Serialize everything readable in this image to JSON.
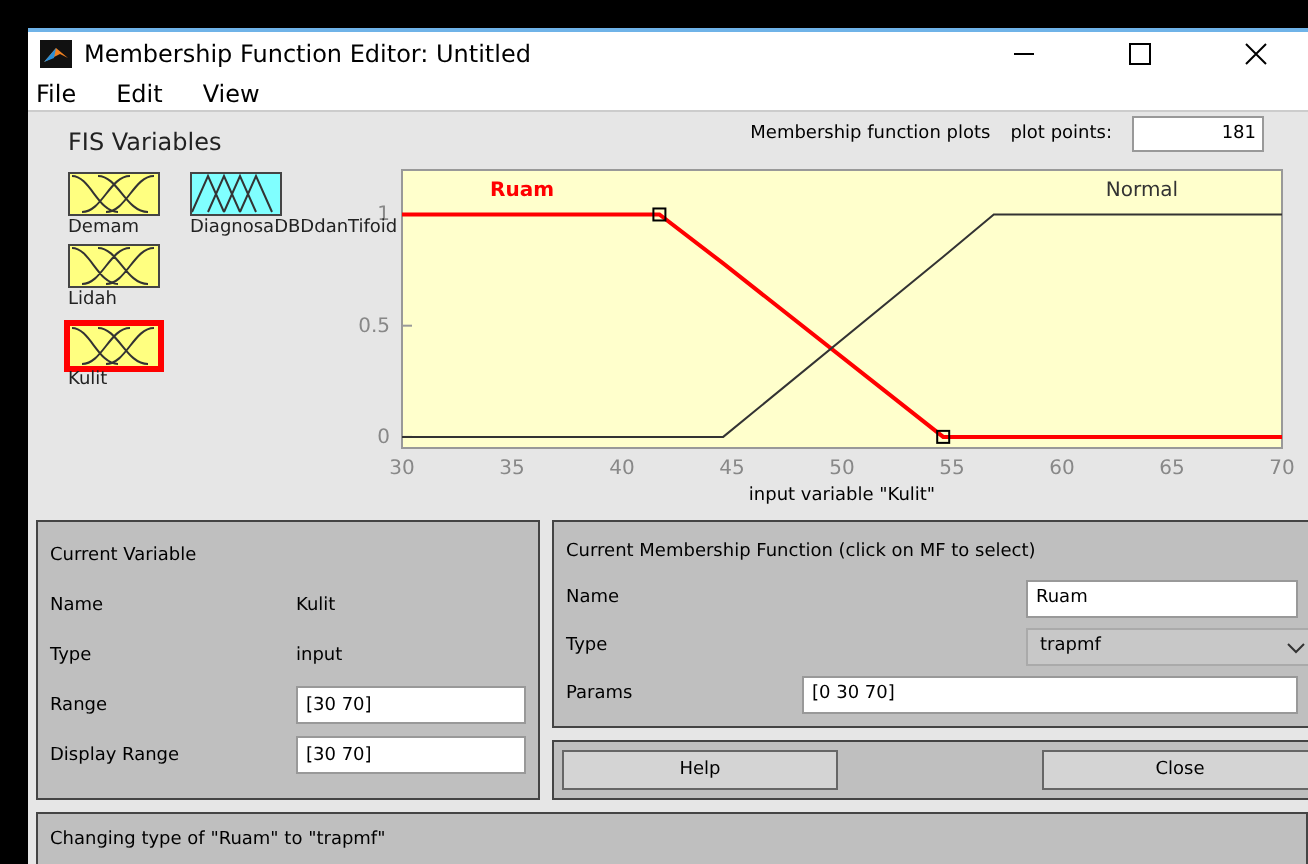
{
  "window": {
    "title": "Membership Function Editor: Untitled"
  },
  "menu": [
    "File",
    "Edit",
    "View"
  ],
  "fis_variables": {
    "title": "FIS Variables",
    "items": [
      {
        "label": "Demam",
        "kind": "input",
        "selected": false
      },
      {
        "label": "DiagnosaDBDdanTifoid",
        "kind": "output",
        "selected": false
      },
      {
        "label": "Lidah",
        "kind": "input",
        "selected": false
      },
      {
        "label": "Kulit",
        "kind": "input",
        "selected": true
      }
    ]
  },
  "plot": {
    "title": "Membership function plots",
    "plot_points_label": "plot points:",
    "plot_points": "181",
    "chart_data": {
      "type": "line",
      "xlabel": "input variable \"Kulit\"",
      "x": [
        30,
        41.7,
        44.6,
        54.6,
        56.9,
        70
      ],
      "series": [
        {
          "name": "Ruam",
          "color": "#ff0000",
          "values": [
            1,
            1,
            0.78,
            0,
            0,
            0
          ]
        },
        {
          "name": "Normal",
          "color": "#333333",
          "values": [
            0,
            0,
            0,
            0.81,
            1,
            1
          ]
        }
      ],
      "xlim": [
        30,
        70
      ],
      "ylim": [
        -0.05,
        1.2
      ],
      "xticks": [
        30,
        35,
        40,
        45,
        50,
        55,
        60,
        65,
        70
      ],
      "yticks": [
        0,
        0.5,
        1
      ]
    },
    "curves": [
      {
        "selected": true
      },
      {
        "selected": false
      }
    ]
  },
  "current_variable": {
    "title": "Current Variable",
    "name_label": "Name",
    "name": "Kulit",
    "type_label": "Type",
    "type": "input",
    "range_label": "Range",
    "range": "[30 70]",
    "display_range_label": "Display Range",
    "display_range": "[30 70]"
  },
  "current_mf": {
    "title": "Current Membership Function (click on MF to select)",
    "name_label": "Name",
    "name": "Ruam",
    "type_label": "Type",
    "type": "trapmf",
    "params_label": "Params",
    "params": "[0 30 70]"
  },
  "buttons": [
    "Help",
    "Close"
  ],
  "status_bar": "Changing type of \"Ruam\" to \"trapmf\""
}
